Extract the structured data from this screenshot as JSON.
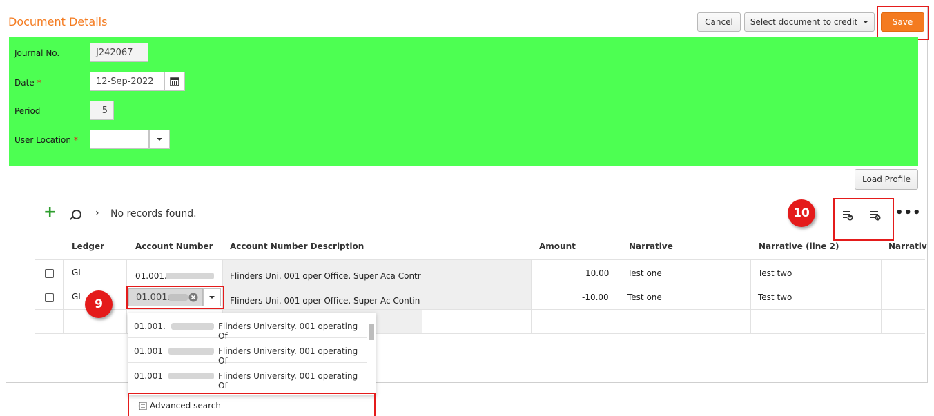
{
  "header": {
    "title": "Document Details",
    "cancel_label": "Cancel",
    "select_doc_label": "Select document to credit",
    "save_label": "Save"
  },
  "form": {
    "journal_label": "Journal No.",
    "journal_value": "J242067",
    "date_label": "Date",
    "date_value": "12-Sep-2022",
    "period_label": "Period",
    "period_value": "5",
    "location_label": "User Location",
    "location_value": "",
    "required_mark": "*"
  },
  "load_profile_label": "Load Profile",
  "grid": {
    "no_records": "No records found.",
    "columns": [
      "Ledger",
      "Account Number",
      "Account Number Description",
      "Amount",
      "Narrative",
      "Narrative (line 2)",
      "Narrativ"
    ],
    "rows": [
      {
        "ledger": "GL",
        "account": "01.001.",
        "description": "Flinders Uni. 001 oper Office. Super Aca Contr",
        "amount": "10.00",
        "narrative": "Test one",
        "narrative2": "Test two"
      },
      {
        "ledger": "GL",
        "account": "01.001.",
        "description": "Flinders Uni. 001 oper Office. Super Ac Contin",
        "amount": "-10.00",
        "narrative": "Test one",
        "narrative2": "Test two"
      }
    ]
  },
  "dropdown": {
    "items": [
      {
        "code": "01.001.",
        "desc": "Flinders University. 001 operating Of"
      },
      {
        "code": "01.001",
        "desc": "Flinders University. 001 operating Of"
      },
      {
        "code": "01.001",
        "desc": "Flinders University. 001 operating Of"
      }
    ],
    "advanced_label": "Advanced search"
  },
  "callouts": {
    "nine": "9",
    "ten": "10"
  },
  "icons": {
    "calendar": "calendar-icon",
    "add": "plus-icon",
    "search": "search-icon",
    "more": "more-icon",
    "export": "export-icon",
    "import": "import-icon",
    "clear": "clear-icon"
  },
  "colors": {
    "accent": "#f47b20",
    "form_bg": "#4dff52",
    "highlight": "#e41b1b"
  }
}
